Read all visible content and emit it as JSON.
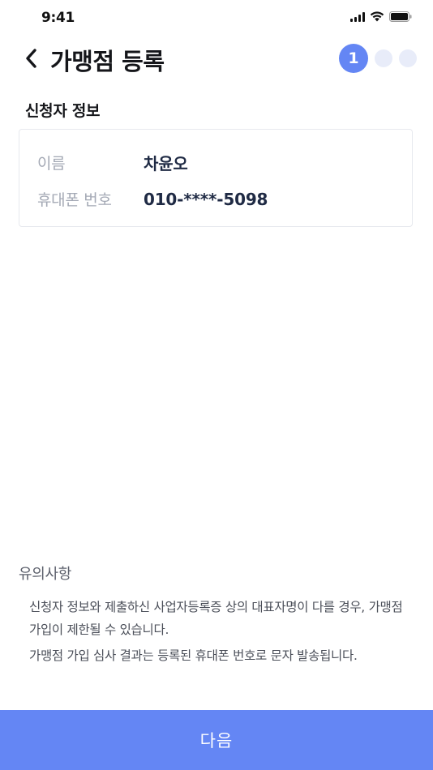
{
  "status_bar": {
    "time": "9:41",
    "icons": [
      "signal-icon",
      "wifi-icon",
      "battery-icon"
    ]
  },
  "header": {
    "title": "가맹점 등록",
    "back_icon": "chevron-left-icon",
    "steps": {
      "current": "1",
      "total": 3
    }
  },
  "applicant": {
    "section_title": "신청자 정보",
    "fields": [
      {
        "label": "이름",
        "value": "차윤오"
      },
      {
        "label": "휴대폰 번호",
        "value": "010-****-5098"
      }
    ]
  },
  "notice": {
    "title": "유의사항",
    "items": [
      "신청자 정보와 제출하신 사업자등록증 상의 대표자명이 다를 경우, 가맹점 가입이 제한될 수 있습니다.",
      "가맹점 가입 심사 결과는 등록된 휴대폰 번호로 문자 발송됩니다."
    ]
  },
  "footer": {
    "next_label": "다음"
  },
  "colors": {
    "accent": "#6486f4",
    "step_inactive": "#e8ecf9",
    "label_gray": "#a4a9b5",
    "value_navy": "#1f2a44"
  }
}
